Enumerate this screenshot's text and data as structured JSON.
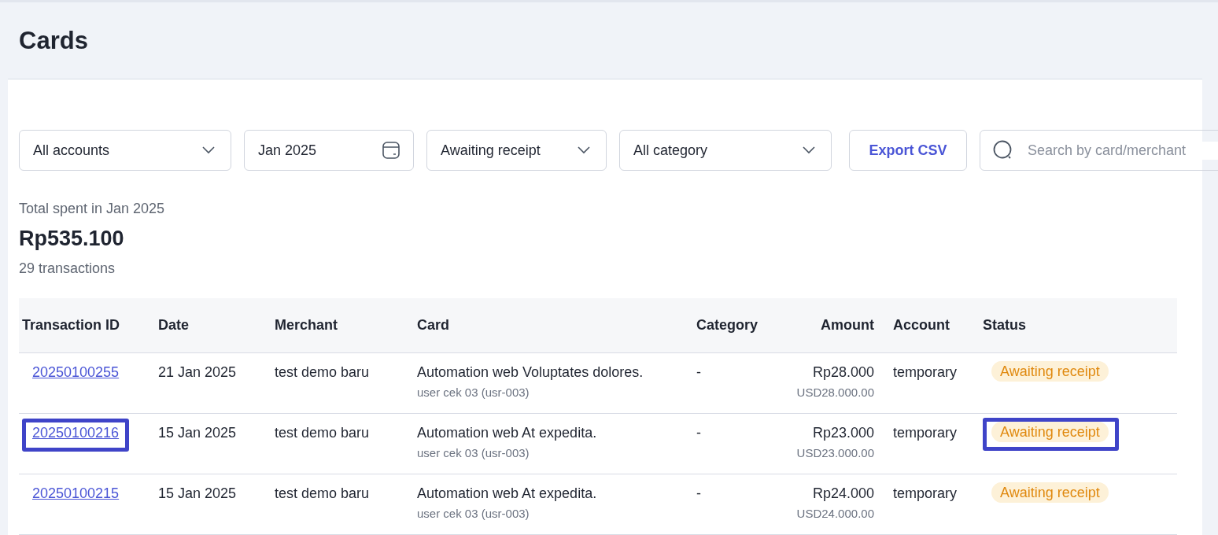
{
  "page": {
    "title": "Cards"
  },
  "filters": [
    {
      "kind": "dropdown",
      "value": "All accounts"
    },
    {
      "kind": "date",
      "value": "Jan 2025"
    },
    {
      "kind": "dropdown",
      "value": "Awaiting receipt"
    },
    {
      "kind": "dropdown",
      "value": "All category"
    }
  ],
  "export_button": "Export CSV",
  "search": {
    "placeholder": "Search by card/merchant"
  },
  "summary": {
    "label": "Total spent in Jan 2025",
    "total": "Rp535.100",
    "count": "29 transactions"
  },
  "table": {
    "columns": [
      "Transaction ID",
      "Date",
      "Merchant",
      "Card",
      "Category",
      "Amount",
      "Account",
      "Status"
    ],
    "rows": [
      {
        "id": "20250100255",
        "date": "21 Jan 2025",
        "merchant": "test demo baru",
        "card": "Automation web Voluptates dolores.",
        "card_user": "user cek 03 (usr-003)",
        "category": "-",
        "amount": "Rp28.000",
        "amount_usd": "USD28.000.00",
        "account": "temporary",
        "status": "Awaiting receipt",
        "highlighted": false
      },
      {
        "id": "20250100216",
        "date": "15 Jan 2025",
        "merchant": "test demo baru",
        "card": "Automation web At expedita.",
        "card_user": "user cek 03 (usr-003)",
        "category": "-",
        "amount": "Rp23.000",
        "amount_usd": "USD23.000.00",
        "account": "temporary",
        "status": "Awaiting receipt",
        "highlighted": true
      },
      {
        "id": "20250100215",
        "date": "15 Jan 2025",
        "merchant": "test demo baru",
        "card": "Automation web At expedita.",
        "card_user": "user cek 03 (usr-003)",
        "category": "-",
        "amount": "Rp24.000",
        "amount_usd": "USD24.000.00",
        "account": "temporary",
        "status": "Awaiting receipt",
        "highlighted": false
      }
    ]
  }
}
